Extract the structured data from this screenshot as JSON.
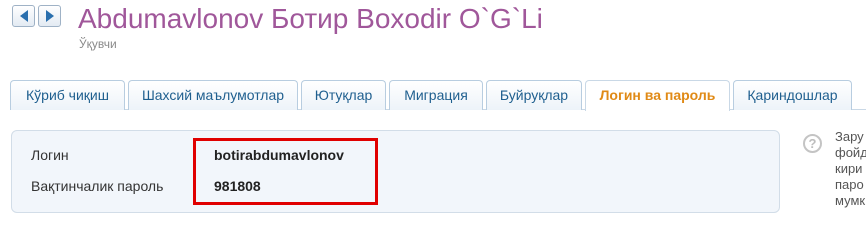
{
  "header": {
    "title": "Abdumavlonov Ботир Boxodir O`G`Li",
    "subtitle": "Ўқувчи",
    "prev_icon": "arrow-left-icon",
    "next_icon": "arrow-right-icon"
  },
  "tabs": [
    {
      "label": "Кўриб чиқиш"
    },
    {
      "label": "Шахсий маълумотлар"
    },
    {
      "label": "Ютуқлар"
    },
    {
      "label": "Миграция"
    },
    {
      "label": "Буйруқлар"
    },
    {
      "label": "Логин ва пароль",
      "active": true
    },
    {
      "label": "Қариндошлар"
    }
  ],
  "credentials": {
    "login_label": "Логин",
    "login_value": "botirabdumavlonov",
    "password_label": "Вақтинчалик пароль",
    "password_value": "981808"
  },
  "help": {
    "icon": "question-icon",
    "icon_text": "?",
    "lines": [
      "Зару",
      "фойд",
      "кири",
      "паро",
      "мумк"
    ]
  },
  "colors": {
    "title": "#a0579a",
    "active_tab": "#e08a16",
    "tab_text": "#1f5f8f",
    "highlight_box": "#e00000"
  }
}
